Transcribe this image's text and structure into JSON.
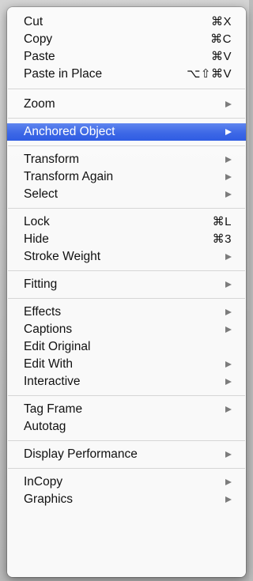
{
  "menu": {
    "groups": [
      {
        "items": [
          {
            "label": "Cut",
            "shortcut": "⌘X",
            "submenu": false
          },
          {
            "label": "Copy",
            "shortcut": "⌘C",
            "submenu": false
          },
          {
            "label": "Paste",
            "shortcut": "⌘V",
            "submenu": false
          },
          {
            "label": "Paste in Place",
            "shortcut": "⌥⇧⌘V",
            "submenu": false
          }
        ]
      },
      {
        "items": [
          {
            "label": "Zoom",
            "shortcut": "",
            "submenu": true
          }
        ]
      },
      {
        "items": [
          {
            "label": "Anchored Object",
            "shortcut": "",
            "submenu": true,
            "highlighted": true
          }
        ]
      },
      {
        "items": [
          {
            "label": "Transform",
            "shortcut": "",
            "submenu": true
          },
          {
            "label": "Transform Again",
            "shortcut": "",
            "submenu": true
          },
          {
            "label": "Select",
            "shortcut": "",
            "submenu": true
          }
        ]
      },
      {
        "items": [
          {
            "label": "Lock",
            "shortcut": "⌘L",
            "submenu": false
          },
          {
            "label": "Hide",
            "shortcut": "⌘3",
            "submenu": false
          },
          {
            "label": "Stroke Weight",
            "shortcut": "",
            "submenu": true
          }
        ]
      },
      {
        "items": [
          {
            "label": "Fitting",
            "shortcut": "",
            "submenu": true
          }
        ]
      },
      {
        "items": [
          {
            "label": "Effects",
            "shortcut": "",
            "submenu": true
          },
          {
            "label": "Captions",
            "shortcut": "",
            "submenu": true
          },
          {
            "label": "Edit Original",
            "shortcut": "",
            "submenu": false
          },
          {
            "label": "Edit With",
            "shortcut": "",
            "submenu": true
          },
          {
            "label": "Interactive",
            "shortcut": "",
            "submenu": true
          }
        ]
      },
      {
        "items": [
          {
            "label": "Tag Frame",
            "shortcut": "",
            "submenu": true
          },
          {
            "label": "Autotag",
            "shortcut": "",
            "submenu": false
          }
        ]
      },
      {
        "items": [
          {
            "label": "Display Performance",
            "shortcut": "",
            "submenu": true
          }
        ]
      },
      {
        "items": [
          {
            "label": "InCopy",
            "shortcut": "",
            "submenu": true
          },
          {
            "label": "Graphics",
            "shortcut": "",
            "submenu": true
          }
        ]
      }
    ]
  },
  "colors": {
    "highlight": "#3d68e6",
    "arrow": "#7c7c7c",
    "separator": "#d6d6d6"
  }
}
